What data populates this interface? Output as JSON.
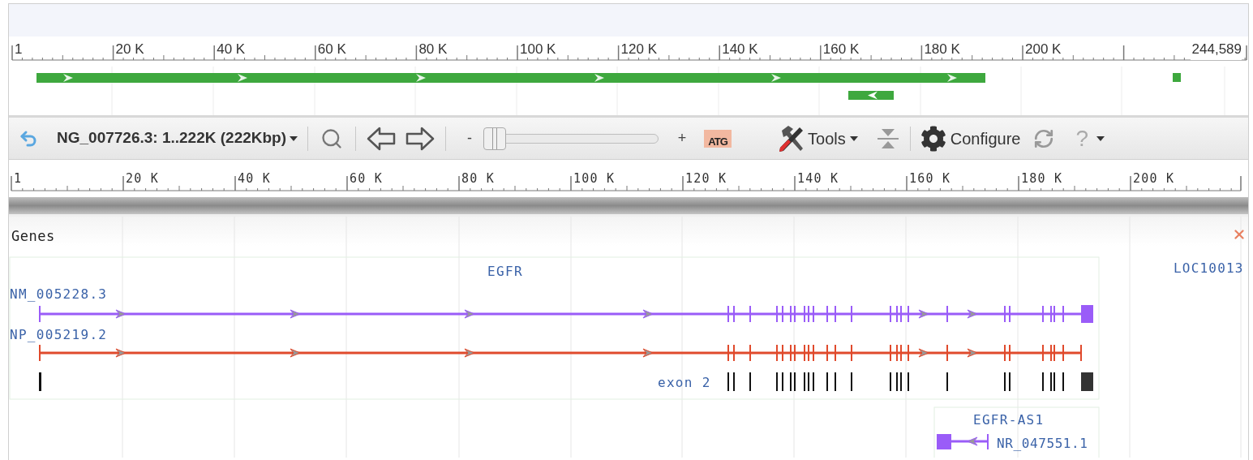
{
  "overview": {
    "ruler_labels": [
      "1",
      "20 K",
      "40 K",
      "60 K",
      "80 K",
      "100 K",
      "120 K",
      "140 K",
      "160 K",
      "180 K",
      "200 K"
    ],
    "end_label": "244,589"
  },
  "toolbar": {
    "sequence": "NG_007726.3: 1..222K (222Kbp)",
    "zoom_out": "-",
    "zoom": {
      "level": 0
    },
    "zoom_in": "+",
    "sequence_icon": "ATG",
    "tools": "Tools",
    "configure": "Configure",
    "help": "?"
  },
  "ruler_labels": [
    "1",
    "20 K",
    "40 K",
    "60 K",
    "80 K",
    "100 K",
    "120 K",
    "140 K",
    "160 K",
    "180 K",
    "200 K"
  ],
  "genes_track": {
    "title": "Genes",
    "genes": [
      {
        "name": "EGFR",
        "exon_label": "exon 2",
        "transcripts": [
          {
            "id": "NM_005228.3",
            "color": "#9a5cf8"
          },
          {
            "id": "NP_005219.2",
            "color": "#e04a2c"
          }
        ]
      },
      {
        "name": "EGFR-AS1",
        "transcripts": [
          {
            "id": "NR_047551.1",
            "color": "#9a5cf8"
          }
        ]
      },
      {
        "name": "LOC10013"
      }
    ]
  }
}
